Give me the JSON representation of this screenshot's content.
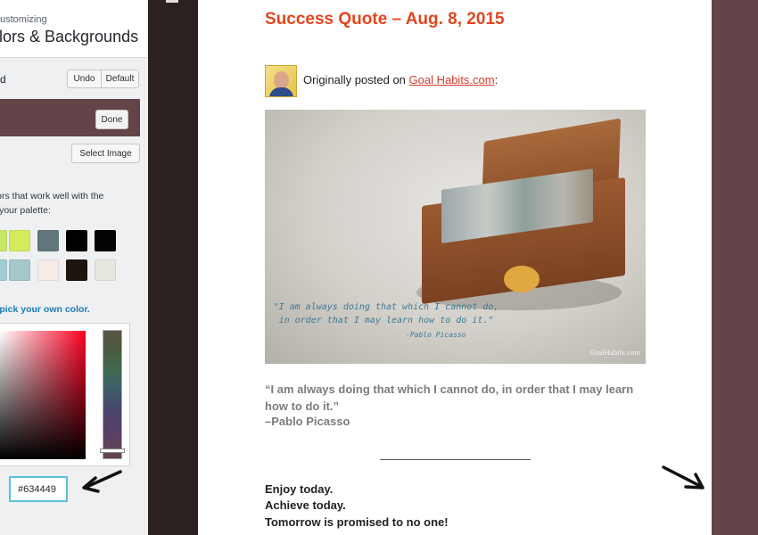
{
  "customizer": {
    "breadcrumb": "ustomizing",
    "section_title": "olors & Backgrounds",
    "control_label": "d",
    "undo_label": "Undo",
    "default_label": "Default",
    "done_label": "Done",
    "select_image_label": "Select Image",
    "palette_description": "olors that work well with the\nin your palette:",
    "pick_own_color": "o pick your own color.",
    "current_color": "#634449",
    "hex_value": "#634449",
    "palette_swatches_row1": [
      "#c9e46a",
      "#d4ec5c",
      "#62767d",
      "#000000",
      "#030303"
    ],
    "palette_swatches_row2": [
      "#9ecdd6",
      "#a4c8cb",
      "#f6ece7",
      "#1e140f",
      "#e8e7de"
    ]
  },
  "preview": {
    "post_title": "Success Quote – Aug. 8, 2015",
    "originally_posted_prefix": "Originally posted on ",
    "site_link": "Goal Habits.com",
    "originally_posted_suffix": ":",
    "photo_quote": "\"I am always doing that which I cannot do,\nin order that I may learn how to do it.\"",
    "photo_author": "-Pablo Picasso",
    "photo_watermark": "GoalHabits.com",
    "quote_text": "“I am always doing that which I cannot do, in order that I may learn how to do it.”",
    "quote_author": "–Pablo Picasso",
    "enjoy_lines": [
      "Enjoy today.",
      "Achieve today.",
      "Tomorrow is promised to no one!"
    ],
    "right_bar_color": "#634449",
    "title_color": "#e2461f"
  }
}
